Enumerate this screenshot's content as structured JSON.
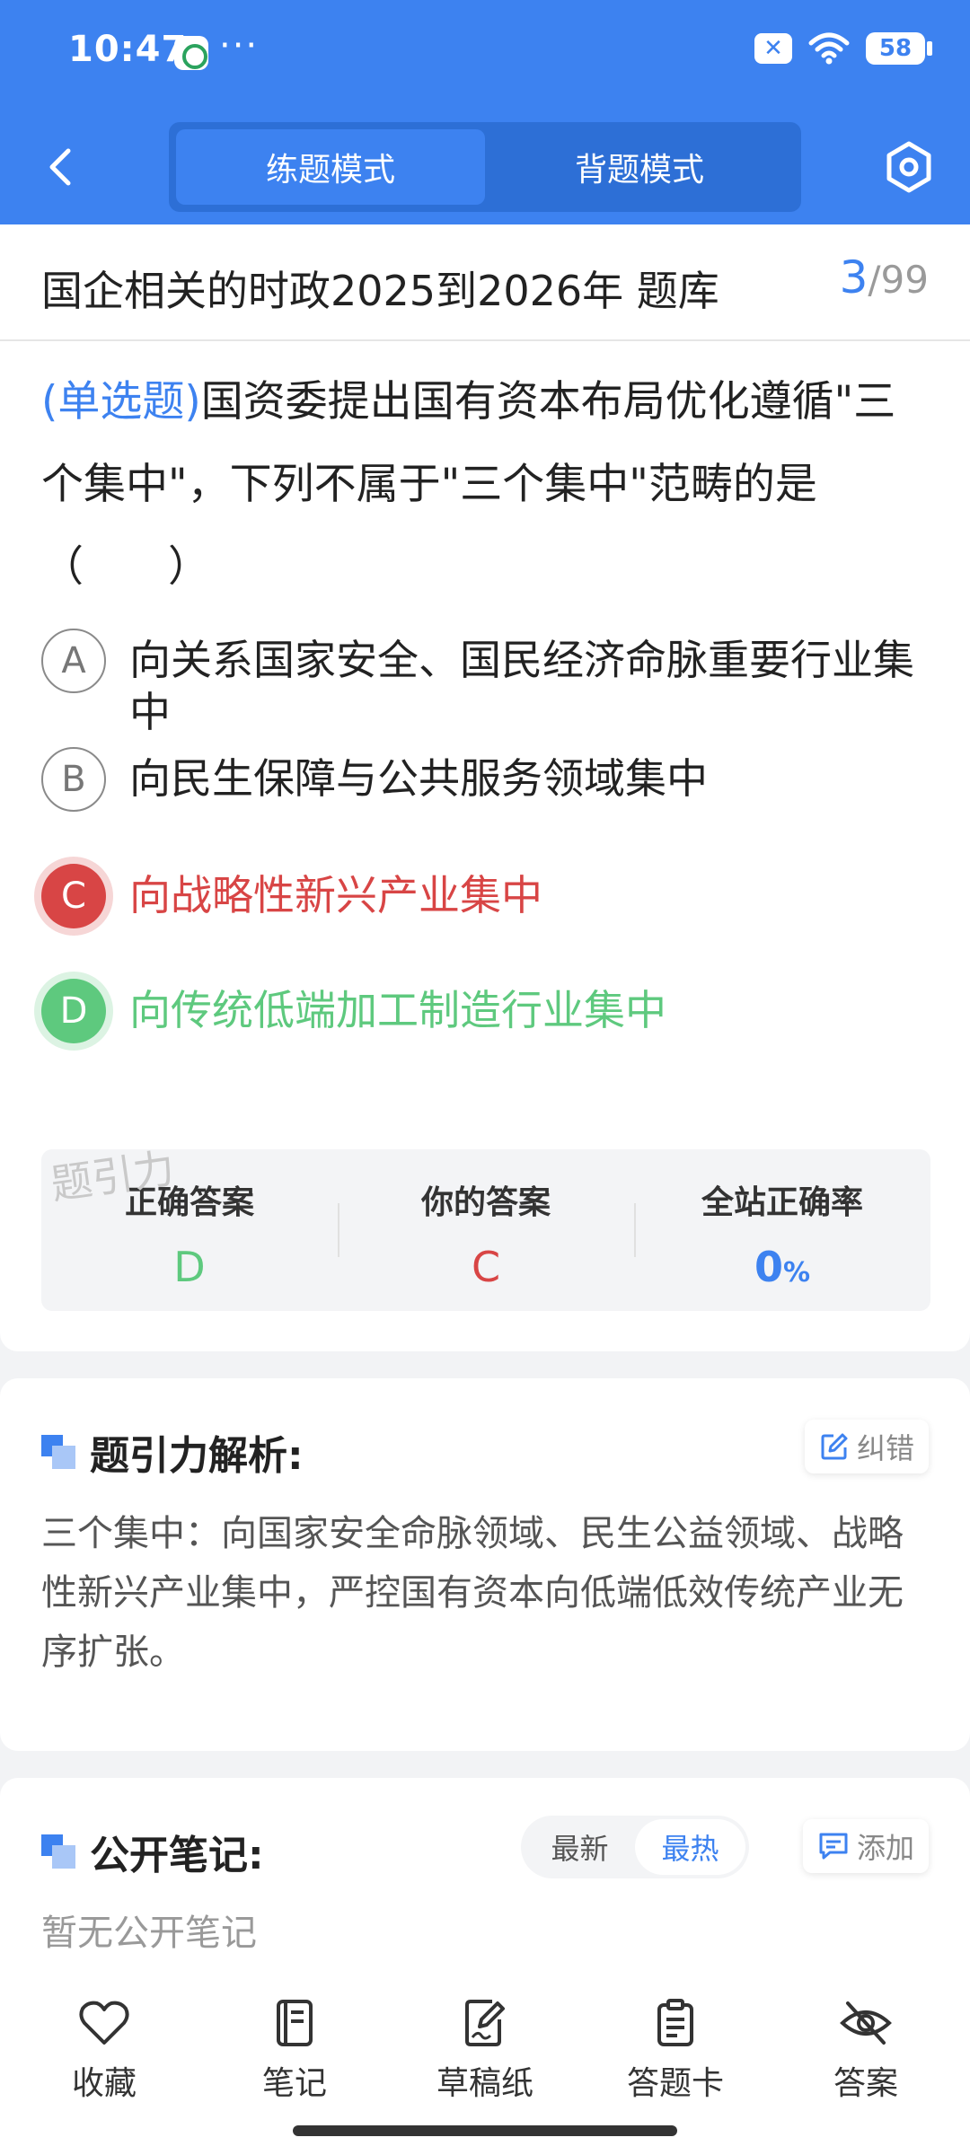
{
  "status_bar": {
    "time": "10:47",
    "dots": "···",
    "battery": "58"
  },
  "nav": {
    "tabs": [
      {
        "label": "练题模式",
        "active": true
      },
      {
        "label": "背题模式",
        "active": false
      }
    ]
  },
  "question": {
    "bank_title": "国企相关的时政2025到2026年 题库",
    "current": "3",
    "separator": "/",
    "total": "99",
    "type_label": "(单选题)",
    "text": "国资委提出国有资本布局优化遵循\"三个集中\"，下列不属于\"三个集中\"范畴的是（　　）",
    "options": [
      {
        "letter": "A",
        "text": "向关系国家安全、国民经济命脉重要行业集中",
        "state": "default"
      },
      {
        "letter": "B",
        "text": "向民生保障与公共服务领域集中",
        "state": "default"
      },
      {
        "letter": "C",
        "text": "向战略性新兴产业集中",
        "state": "wrong"
      },
      {
        "letter": "D",
        "text": "向传统低端加工制造行业集中",
        "state": "correct"
      }
    ]
  },
  "watermark": "题引力",
  "stats": {
    "correct_label": "正确答案",
    "correct_value": "D",
    "yours_label": "你的答案",
    "yours_value": "C",
    "rate_label": "全站正确率",
    "rate_value": "0",
    "rate_unit": "%"
  },
  "analysis": {
    "title": "题引力解析:",
    "report_label": "纠错",
    "text": "三个集中：向国家安全命脉领域、民生公益领域、战略性新兴产业集中，严控国有资本向低端低效传统产业无序扩张。"
  },
  "notes": {
    "title": "公开笔记:",
    "sort_options": [
      "最新",
      "最热"
    ],
    "add_label": "添加",
    "empty_text": "暂无公开笔记"
  },
  "bottom_bar": {
    "items": [
      {
        "label": "收藏",
        "icon": "heart-icon"
      },
      {
        "label": "笔记",
        "icon": "notebook-icon"
      },
      {
        "label": "草稿纸",
        "icon": "draft-icon"
      },
      {
        "label": "答题卡",
        "icon": "answer-card-icon"
      },
      {
        "label": "答案",
        "icon": "eye-off-icon"
      }
    ]
  },
  "colors": {
    "primary": "#3d82f0",
    "wrong": "#d84545",
    "correct": "#5ec97e"
  }
}
